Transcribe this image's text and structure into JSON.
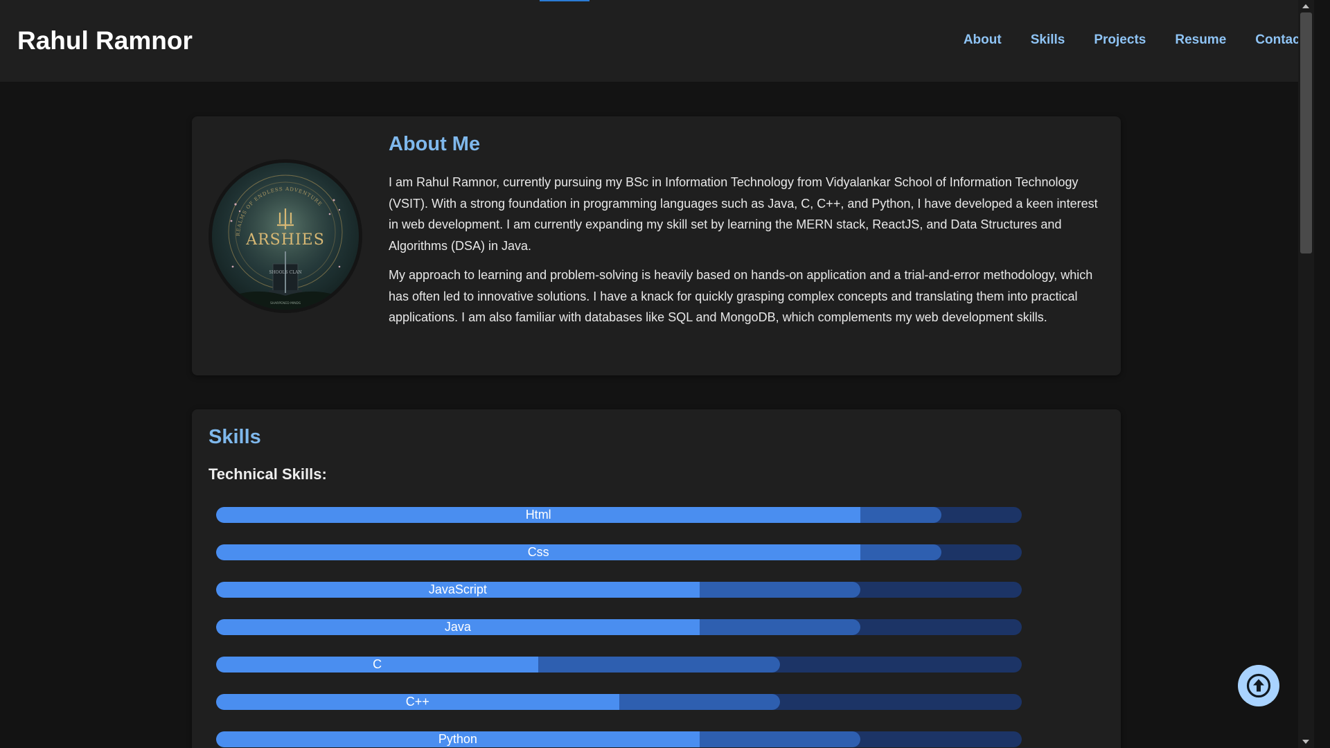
{
  "header": {
    "title": "Rahul Ramnor",
    "nav": [
      "About",
      "Skills",
      "Projects",
      "Resume",
      "Contact"
    ]
  },
  "about": {
    "title": "About Me",
    "paragraphs": [
      "I am Rahul Ramnor, currently pursuing my BSc in Information Technology from Vidyalankar School of Information Technology (VSIT). With a strong foundation in programming languages such as Java, C, C++, and Python, I have developed a keen interest in web development. I am currently expanding my skill set by learning the MERN stack, ReactJS, and Data Structures and Algorithms (DSA) in Java.",
      "My approach to learning and problem-solving is heavily based on hands-on application and a trial-and-error methodology, which has often led to innovative solutions. I have a knack for quickly grasping complex concepts and translating them into practical applications. I am also familiar with databases like SQL and MongoDB, which complements my web development skills."
    ],
    "avatar": {
      "arc_text": "REALMS OF ENDLESS ADVENTURE",
      "logo_text": "ARSHIES",
      "sign_text": "SHOOLS CLAN",
      "bottom_text": "SHARPENED MINDS"
    }
  },
  "skills": {
    "title": "Skills",
    "subtitle": "Technical Skills:",
    "bars": [
      {
        "name": "Html",
        "level": 0.8,
        "secondary": 0.9
      },
      {
        "name": "Css",
        "level": 0.8,
        "secondary": 0.9
      },
      {
        "name": "JavaScript",
        "level": 0.6,
        "secondary": 0.8
      },
      {
        "name": "Java",
        "level": 0.6,
        "secondary": 0.8
      },
      {
        "name": "C",
        "level": 0.4,
        "secondary": 0.7
      },
      {
        "name": "C++",
        "level": 0.5,
        "secondary": 0.7
      },
      {
        "name": "Python",
        "level": 0.6,
        "secondary": 0.8
      }
    ]
  },
  "colors": {
    "accent": "#7fb8ec",
    "bar_fill": "#4a8ef0",
    "bar_secondary": "#2e5fb0",
    "bar_track": "#1c3466",
    "back_to_top": "#a9d3ff"
  },
  "icons": {
    "back_to_top": "arrow-up-circle-icon"
  }
}
